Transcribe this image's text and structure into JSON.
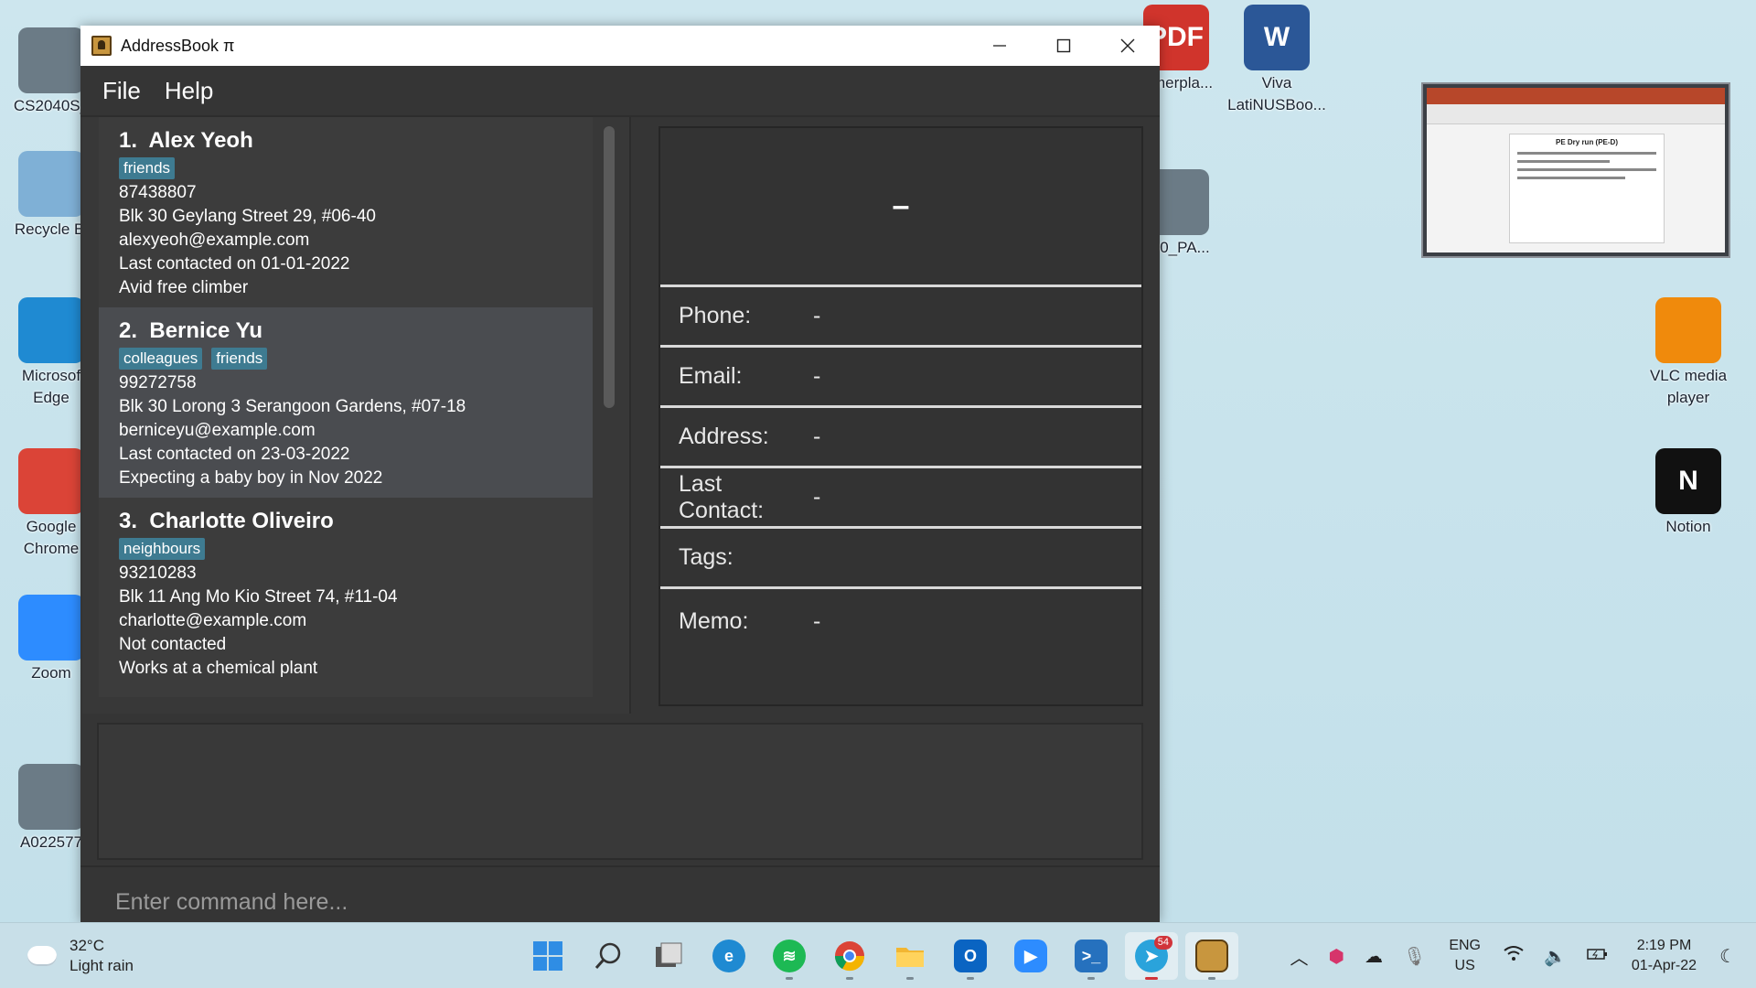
{
  "desktop": {
    "icons": [
      {
        "label": "CS2040S_",
        "name": "desktop-icon-cs2040s",
        "color": "#6b7b86"
      },
      {
        "label": "Recycle Bi",
        "name": "desktop-icon-recycle-bin",
        "color": "#7fb0d6"
      },
      {
        "label": "Microsof",
        "label2": "Edge",
        "name": "desktop-icon-edge",
        "color": "#1f8ad2"
      },
      {
        "label": "Google",
        "label2": "Chrome",
        "name": "desktop-icon-chrome",
        "color": "#db4437"
      },
      {
        "label": "Zoom",
        "name": "desktop-icon-zoom",
        "color": "#2d8cff"
      },
      {
        "label": "A022577",
        "name": "desktop-icon-a022577",
        "color": "#6b7b86"
      },
      {
        "label": "mmerpla...",
        "name": "desktop-icon-pdf",
        "color": "#d0342c",
        "glyph": "PDF"
      },
      {
        "label": "Viva",
        "label2": "LatiNUSBoo...",
        "name": "desktop-icon-word",
        "color": "#2b5797",
        "glyph": "W"
      },
      {
        "label": "030_PA...",
        "name": "desktop-icon-video",
        "color": "#6b7b86"
      },
      {
        "label": "VLC media",
        "label2": "player",
        "name": "desktop-icon-vlc",
        "color": "#f08a0c"
      },
      {
        "label": "Notion",
        "name": "desktop-icon-notion",
        "color": "#111111",
        "glyph": "N"
      }
    ],
    "preview_title": "PE Dry run (PE-D)"
  },
  "window": {
    "title": "AddressBook π",
    "menus": [
      "File",
      "Help"
    ]
  },
  "persons": [
    {
      "index": "1.",
      "name": "Alex Yeoh",
      "tags": [
        "friends"
      ],
      "phone": "87438807",
      "address": "Blk 30 Geylang Street 29, #06-40",
      "email": "alexyeoh@example.com",
      "last_contacted": "Last contacted on 01-01-2022",
      "memo": "Avid free climber"
    },
    {
      "index": "2.",
      "name": "Bernice Yu",
      "tags": [
        "colleagues",
        "friends"
      ],
      "phone": "99272758",
      "address": "Blk 30 Lorong 3 Serangoon Gardens, #07-18",
      "email": "berniceyu@example.com",
      "last_contacted": "Last contacted on 23-03-2022",
      "memo": "Expecting a baby boy in Nov 2022"
    },
    {
      "index": "3.",
      "name": "Charlotte Oliveiro",
      "tags": [
        "neighbours"
      ],
      "phone": "93210283",
      "address": "Blk 11 Ang Mo Kio Street 74, #11-04",
      "email": "charlotte@example.com",
      "last_contacted": "Not contacted",
      "memo": "Works at a chemical plant"
    }
  ],
  "detail": {
    "header": "–",
    "rows": [
      {
        "label": "Phone:",
        "value": "-"
      },
      {
        "label": "Email:",
        "value": "-"
      },
      {
        "label": "Address:",
        "value": "-"
      },
      {
        "label": "Last Contact:",
        "value": "-"
      },
      {
        "label": "Tags:",
        "value": ""
      },
      {
        "label": "Memo:",
        "value": "-"
      }
    ]
  },
  "command": {
    "placeholder": "Enter command here...",
    "value": ""
  },
  "taskbar": {
    "weather_temp": "32°C",
    "weather_desc": "Light rain",
    "outlook_badge": "",
    "telegram_badge": "54",
    "lang_line1": "ENG",
    "lang_line2": "US",
    "time": "2:19 PM",
    "date": "01-Apr-22"
  }
}
